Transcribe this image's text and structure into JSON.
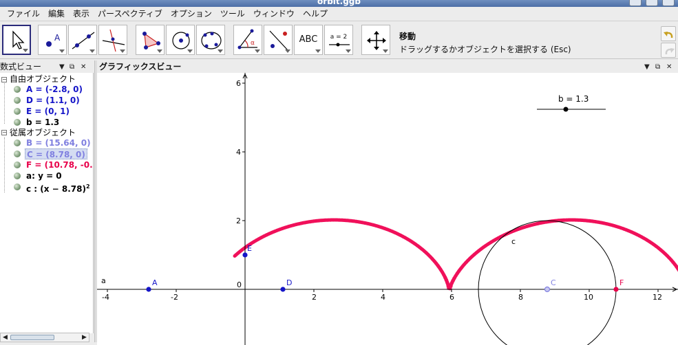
{
  "window": {
    "title": "orbit.ggb"
  },
  "menu": [
    "ファイル",
    "編集",
    "表示",
    "パースペクティブ",
    "オプション",
    "ツール",
    "ウィンドウ",
    "ヘルプ"
  ],
  "toolbar": {
    "text_tool_label": "ABC",
    "slider_tool_label": "a = 2",
    "current_tool_name": "移動",
    "current_tool_desc": "ドラッグするかオブジェクトを選択する (Esc)"
  },
  "algebra": {
    "title": "数式ビュー",
    "groups": [
      {
        "label": "自由オブジェクト",
        "items": [
          {
            "text": "A = (-2.8, 0)",
            "color": "#1515c8"
          },
          {
            "text": "D = (1.1, 0)",
            "color": "#1515c8"
          },
          {
            "text": "E = (0, 1)",
            "color": "#1515c8"
          },
          {
            "text": "b = 1.3",
            "color": "#000000"
          }
        ]
      },
      {
        "label": "従属オブジェクト",
        "items": [
          {
            "text": "B = (15.64, 0)",
            "color": "#8080e0"
          },
          {
            "text": "C = (8.78, 0)",
            "color": "#8080e0"
          },
          {
            "text": "F = (10.78, -0.",
            "color": "#e8004a"
          },
          {
            "text": "a: y = 0",
            "color": "#000000"
          },
          {
            "text": "c : (x − 8.78)",
            "sup": "2",
            "color": "#000000"
          }
        ]
      }
    ]
  },
  "graphics": {
    "title": "グラフィックスビュー",
    "slider_label": "b = 1.3",
    "line_label": "a",
    "circle_label": "c",
    "x_ticks": [
      "-4",
      "-2",
      "0",
      "2",
      "4",
      "6",
      "8",
      "10",
      "12"
    ],
    "y_ticks": [
      "2",
      "4",
      "6"
    ],
    "origin_label": "0",
    "points": [
      {
        "name": "A",
        "x": -2.8,
        "y": 0,
        "color": "#1515c8"
      },
      {
        "name": "D",
        "x": 1.1,
        "y": 0,
        "color": "#1515c8"
      },
      {
        "name": "E",
        "x": 0,
        "y": 1,
        "color": "#1515c8"
      },
      {
        "name": "C",
        "x": 8.78,
        "y": 0,
        "color": "#8080e0"
      },
      {
        "name": "F",
        "x": 10.78,
        "y": 0,
        "color": "#e8004a"
      }
    ],
    "circle": {
      "cx": 8.78,
      "cy": 0,
      "r": 2
    },
    "trace_color": "#f0105a",
    "colors": {
      "axis": "#000000",
      "trace": "#f0105a"
    }
  }
}
